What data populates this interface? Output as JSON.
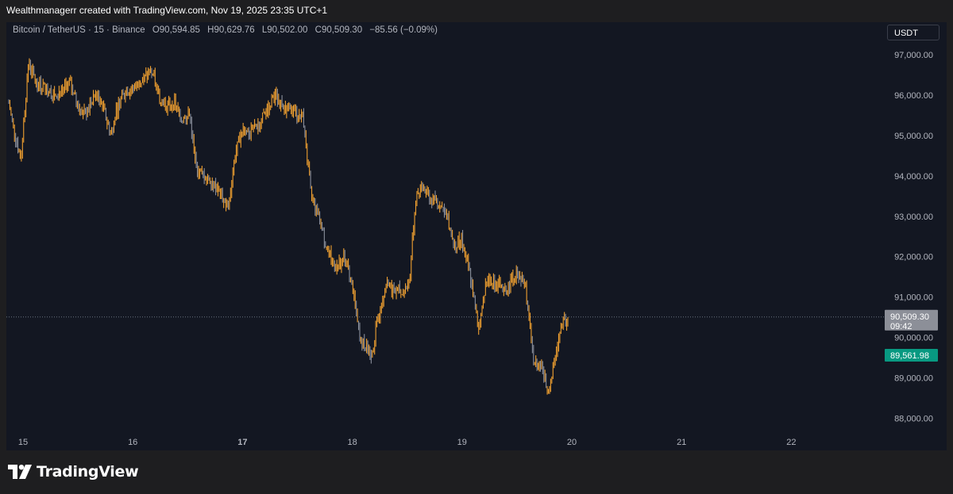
{
  "header": {
    "attribution": "Wealthmanagerr created with TradingView.com, Nov 19, 2025 23:35 UTC+1"
  },
  "legend": {
    "symbol": "Bitcoin / TetherUS · 15 · Binance",
    "open_label": "O",
    "open_value": "90,594.85",
    "high_label": "H",
    "high_value": "90,629.76",
    "low_label": "L",
    "low_value": "90,502.00",
    "close_label": "C",
    "close_value": "90,509.30",
    "change": "−85.56 (−0.09%)"
  },
  "currency_button": "USDT",
  "footer": {
    "brand": "TradingView",
    "logo_icon": "tradingview-logo-icon"
  },
  "colors": {
    "background": "#131722",
    "up_candle": "#f0a030",
    "down_candle": "#8a8f9c",
    "last_price_badge": "#8c8f98",
    "marker_badge": "#089981",
    "axis_text": "#b2b5be"
  },
  "chart_data": {
    "type": "line",
    "title": "",
    "xlabel": "",
    "ylabel": "",
    "ylim": [
      87700,
      97800
    ],
    "xlim": [
      15,
      22.5
    ],
    "x_ticks": [
      "15",
      "16",
      "17",
      "18",
      "19",
      "20",
      "21",
      "22"
    ],
    "y_ticks": [
      "97,000.00",
      "96,000.00",
      "95,000.00",
      "94,000.00",
      "93,000.00",
      "92,000.00",
      "91,000.00",
      "90,000.00",
      "89,000.00",
      "88,000.00"
    ],
    "y_tick_values": [
      97000,
      96000,
      95000,
      94000,
      93000,
      92000,
      91000,
      90000,
      89000,
      88000
    ],
    "series": [
      {
        "x": [
          14.87,
          14.92,
          14.98,
          15.05,
          15.12,
          15.2,
          15.27,
          15.35,
          15.43,
          15.5,
          15.58,
          15.65,
          15.72,
          15.8,
          15.87,
          15.95,
          16.02,
          16.1,
          16.17,
          16.25,
          16.32,
          16.38,
          16.45,
          16.52,
          16.58,
          16.65,
          16.72,
          16.8,
          16.87,
          16.93,
          17.0,
          17.07,
          17.15,
          17.22,
          17.3,
          17.38,
          17.45,
          17.5,
          17.55,
          17.62,
          17.7,
          17.78,
          17.85,
          17.92,
          18.0,
          18.07,
          18.12,
          18.18,
          18.23,
          18.3,
          18.38,
          18.45,
          18.52,
          18.58,
          18.65,
          18.72,
          18.8,
          18.87,
          18.93,
          19.0,
          19.07,
          19.15,
          19.22,
          19.3,
          19.38,
          19.45,
          19.52,
          19.58,
          19.65,
          19.72,
          19.78,
          19.85,
          19.92,
          19.97
        ],
        "y": [
          95800,
          95100,
          94400,
          96800,
          96300,
          96200,
          96000,
          96100,
          96300,
          95700,
          95600,
          96000,
          95800,
          95000,
          95800,
          96100,
          96200,
          96400,
          96600,
          95900,
          95700,
          95800,
          95400,
          95500,
          94100,
          94000,
          93900,
          93500,
          93200,
          94500,
          95200,
          95100,
          95300,
          95600,
          96000,
          95700,
          95600,
          95500,
          95500,
          93600,
          92900,
          92100,
          91700,
          92000,
          91300,
          89900,
          89800,
          89600,
          90400,
          91300,
          91200,
          91100,
          91400,
          93500,
          93700,
          93400,
          93300,
          92900,
          92300,
          92400,
          91600,
          90200,
          91400,
          91400,
          91100,
          91400,
          91600,
          91200,
          89400,
          89300,
          88700,
          89500,
          90400,
          90509.3
        ],
        "values": [
          95800,
          95100,
          94400,
          96800,
          96300,
          96200,
          96000,
          96100,
          96300,
          95700,
          95600,
          96000,
          95800,
          95000,
          95800,
          96100,
          96200,
          96400,
          96600,
          95900,
          95700,
          95800,
          95400,
          95500,
          94100,
          94000,
          93900,
          93500,
          93200,
          94500,
          95200,
          95100,
          95300,
          95600,
          96000,
          95700,
          95600,
          95500,
          95500,
          93600,
          92900,
          92100,
          91700,
          92000,
          91300,
          89900,
          89800,
          89600,
          90400,
          91300,
          91200,
          91100,
          91400,
          93500,
          93700,
          93400,
          93300,
          92900,
          92300,
          92400,
          91600,
          90200,
          91400,
          91400,
          91100,
          91400,
          91600,
          91200,
          89400,
          89300,
          88700,
          89500,
          90400,
          90509.3
        ]
      }
    ],
    "last_price": 90509.3,
    "last_price_label": "90,509.30",
    "countdown_label": "09:42",
    "marker_price": 89561.98,
    "marker_price_label": "89,561.98"
  }
}
